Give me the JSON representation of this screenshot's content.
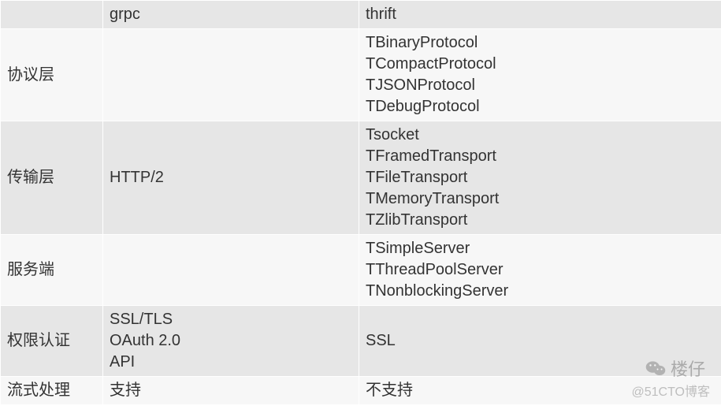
{
  "table": {
    "header": {
      "col0": "",
      "col1": "grpc",
      "col2": "thrift"
    },
    "rows": [
      {
        "label": "协议层",
        "grpc": "",
        "thrift": "TBinaryProtocol\nTCompactProtocol\nTJSONProtocol\nTDebugProtocol"
      },
      {
        "label": "传输层",
        "grpc": "HTTP/2",
        "thrift": "Tsocket\nTFramedTransport\nTFileTransport\nTMemoryTransport\nTZlibTransport"
      },
      {
        "label": "服务端",
        "grpc": "",
        "thrift": "TSimpleServer\nTThreadPoolServer\nTNonblockingServer"
      },
      {
        "label": "权限认证",
        "grpc": "SSL/TLS\nOAuth 2.0\nAPI",
        "thrift": "SSL"
      },
      {
        "label": "流式处理",
        "grpc": "支持",
        "thrift": "不支持"
      }
    ]
  },
  "watermark": {
    "author": "楼仔",
    "site": "@51CTO博客"
  }
}
